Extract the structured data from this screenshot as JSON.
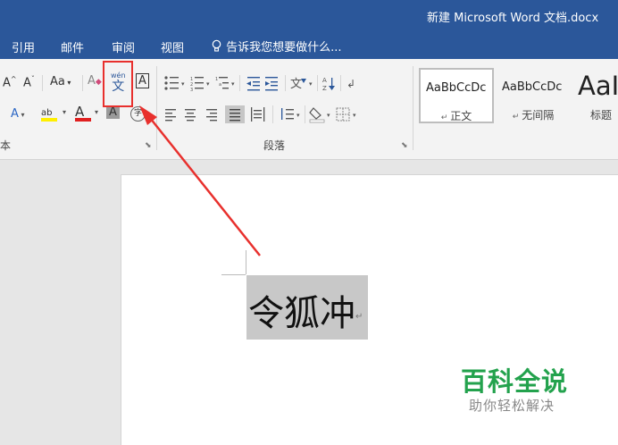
{
  "window": {
    "title": "新建 Microsoft Word 文档.docx"
  },
  "tabs": [
    "引用",
    "邮件",
    "审阅",
    "视图"
  ],
  "tell_me": "告诉我您想要做什么...",
  "ribbon": {
    "font": {
      "grow_font": "A",
      "shrink_font": "A",
      "change_case": "Aa",
      "phonetic_guide": {
        "top": "wén",
        "bottom": "文"
      },
      "char_border": "A",
      "text_effects": "A",
      "highlight": "ab",
      "font_color": "A",
      "char_shading": "A",
      "enclose_char": "字",
      "group_label": "本"
    },
    "paragraph": {
      "group_label": "段落"
    },
    "styles": [
      {
        "sample": "AaBbCcDc",
        "name": "正文"
      },
      {
        "sample": "AaBbCcDc",
        "name": "无间隔"
      },
      {
        "sample": "AaI",
        "name": "标题"
      }
    ]
  },
  "document": {
    "selected_text": "令狐冲"
  },
  "watermark": {
    "title": "百科全说",
    "subtitle": "助你轻松解决"
  },
  "colors": {
    "title_bar": "#2b579a",
    "highlight_box": "#e8302d",
    "watermark": "#23a24d"
  }
}
